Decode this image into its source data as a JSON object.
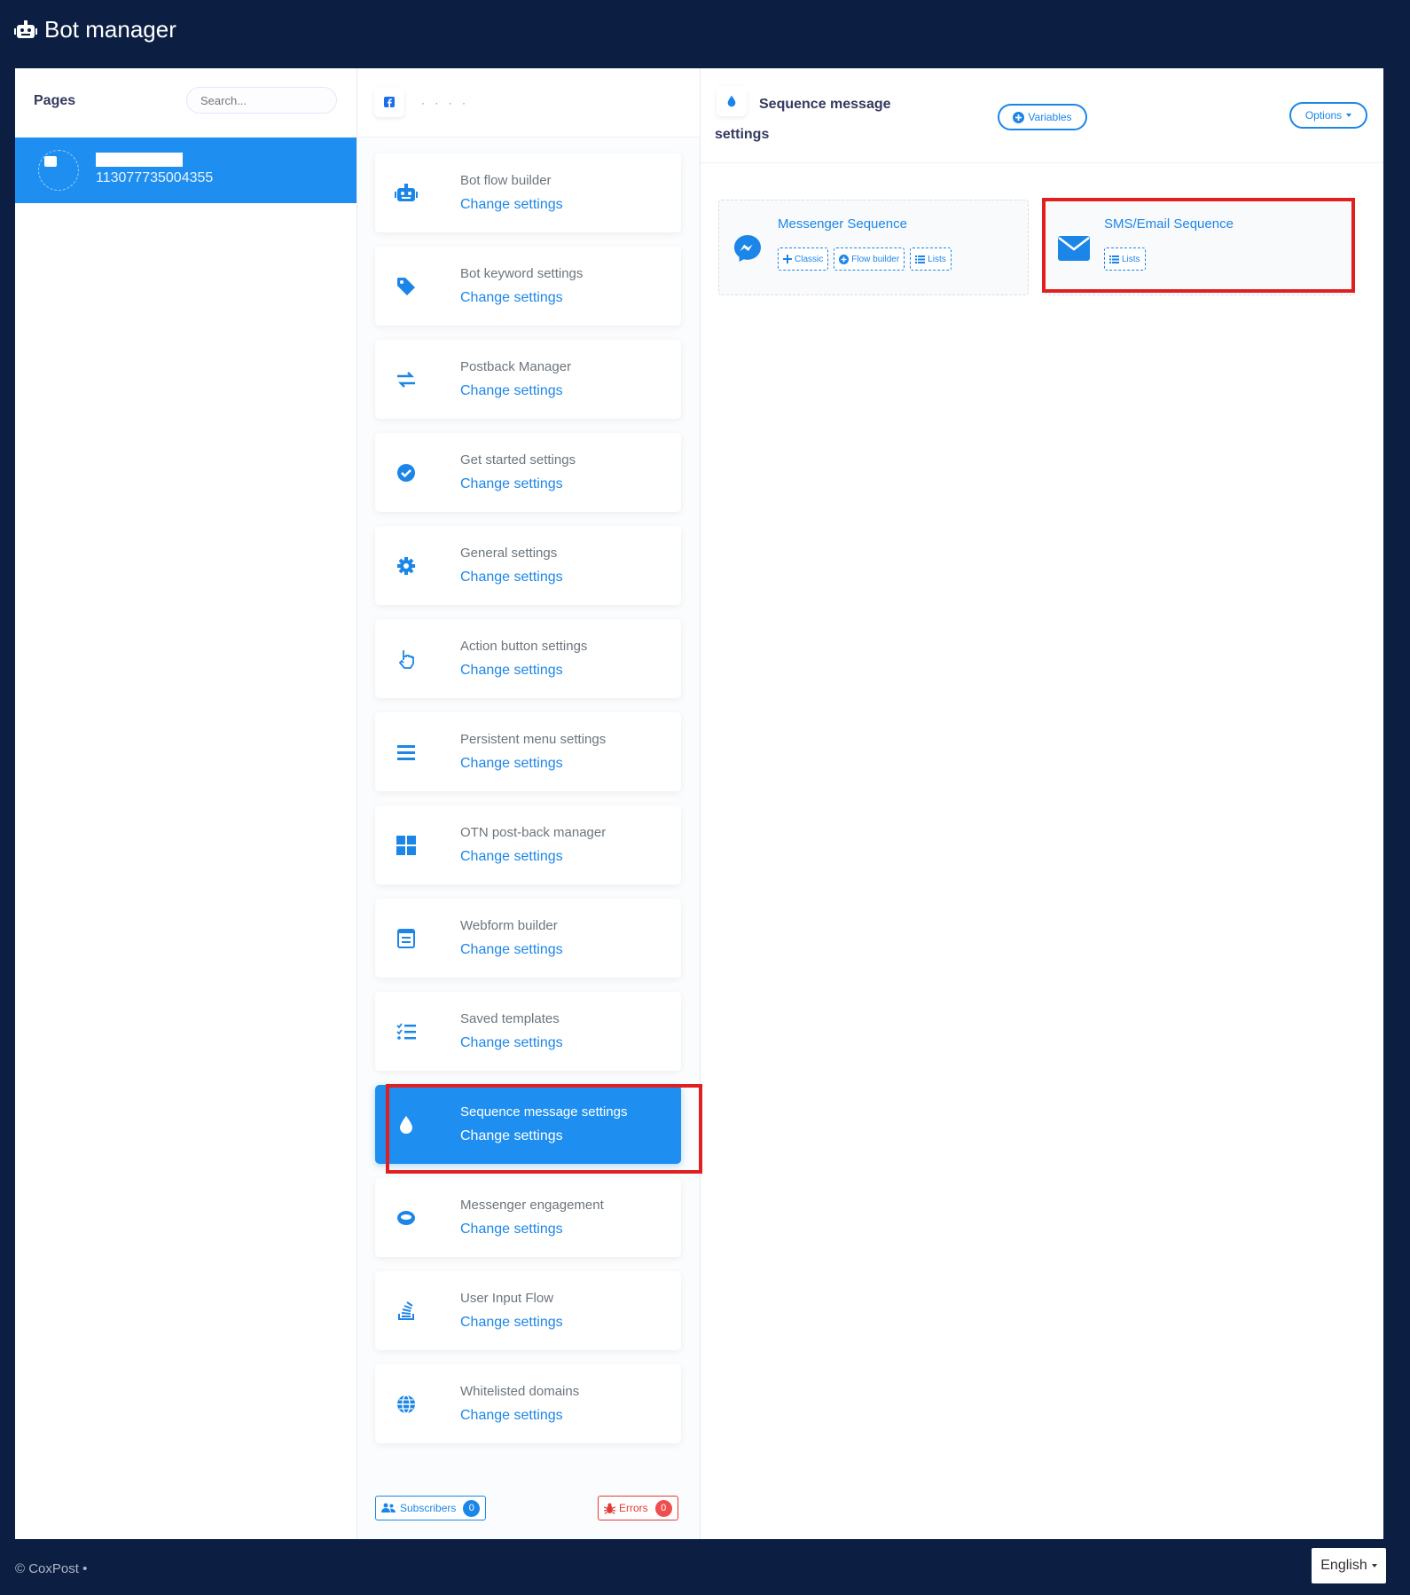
{
  "app": {
    "title": "Bot manager"
  },
  "pages": {
    "title": "Pages",
    "search_placeholder": "Search...",
    "items": [
      {
        "id": "113077735004355"
      }
    ]
  },
  "menu": {
    "items": [
      {
        "label": "Bot flow builder",
        "link": "Change settings",
        "icon": "robot-icon"
      },
      {
        "label": "Bot keyword settings",
        "link": "Change settings",
        "icon": "tag-icon"
      },
      {
        "label": "Postback Manager",
        "link": "Change settings",
        "icon": "exchange-icon"
      },
      {
        "label": "Get started settings",
        "link": "Change settings",
        "icon": "check-circle-icon"
      },
      {
        "label": "General settings",
        "link": "Change settings",
        "icon": "gear-icon"
      },
      {
        "label": "Action button settings",
        "link": "Change settings",
        "icon": "pointer-hand-icon"
      },
      {
        "label": "Persistent menu settings",
        "link": "Change settings",
        "icon": "menu-bars-icon"
      },
      {
        "label": "OTN post-back manager",
        "link": "Change settings",
        "icon": "grid-icon"
      },
      {
        "label": "Webform builder",
        "link": "Change settings",
        "icon": "form-icon"
      },
      {
        "label": "Saved templates",
        "link": "Change settings",
        "icon": "tasks-icon"
      },
      {
        "label": "Sequence message settings",
        "link": "Change settings",
        "icon": "drop-icon",
        "active": true
      },
      {
        "label": "Messenger engagement",
        "link": "Change settings",
        "icon": "ring-icon"
      },
      {
        "label": "User Input Flow",
        "link": "Change settings",
        "icon": "stack-icon"
      },
      {
        "label": "Whitelisted domains",
        "link": "Change settings",
        "icon": "globe-icon"
      }
    ],
    "subscribers": {
      "label": "Subscribers",
      "count": "0"
    },
    "errors": {
      "label": "Errors",
      "count": "0"
    }
  },
  "detail": {
    "title": "Sequence message settings",
    "variables_label": "Variables",
    "options_label": "Options",
    "cards": {
      "messenger": {
        "title": "Messenger Sequence",
        "chips": [
          "Classic",
          "Flow builder",
          "Lists"
        ]
      },
      "sms_email": {
        "title": "SMS/Email Sequence",
        "chips": [
          "Lists"
        ]
      }
    }
  },
  "footer": {
    "copyright": "© CoxPost  •",
    "language": "English"
  },
  "colors": {
    "accent": "#1e8ff0",
    "link": "#1c86e8",
    "navy": "#0c1f42",
    "highlight": "#e02020"
  }
}
